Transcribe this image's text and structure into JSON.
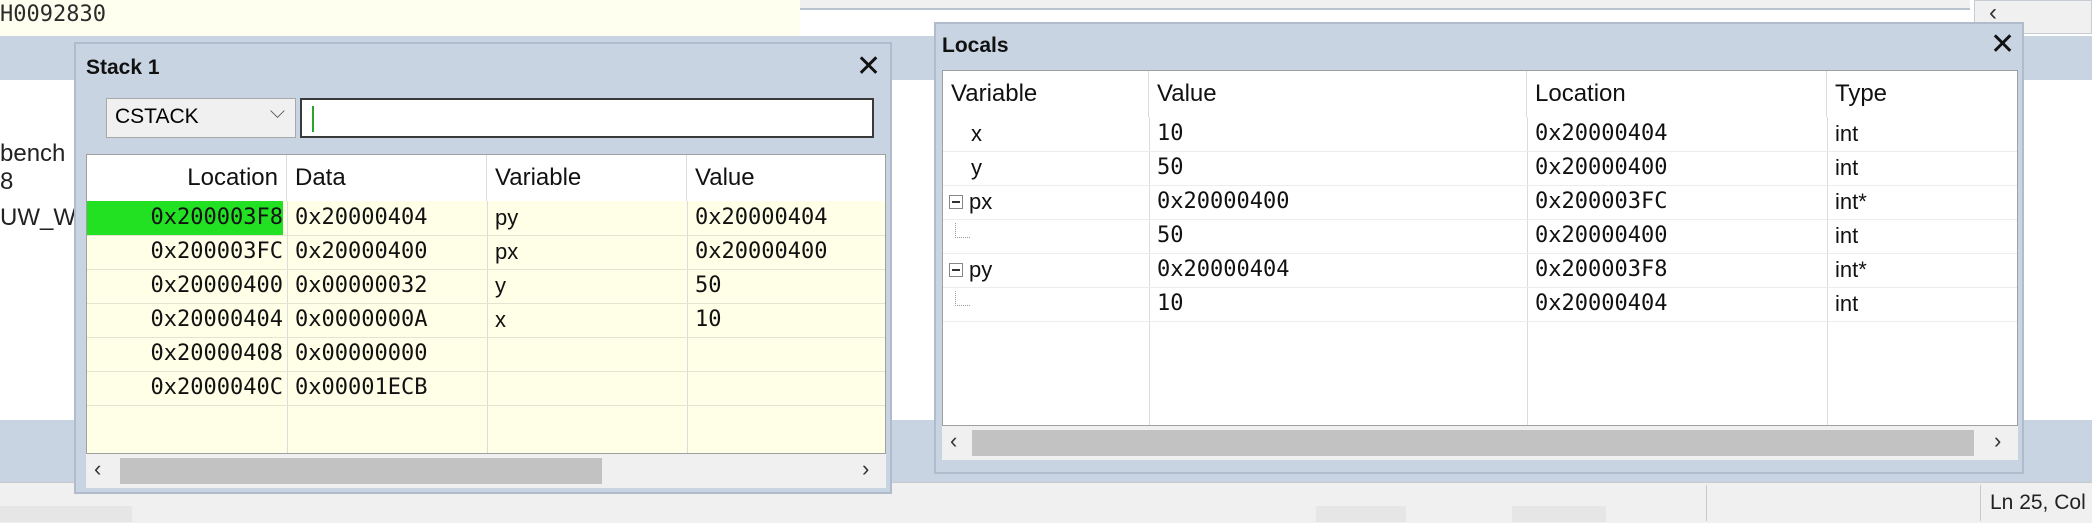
{
  "background": {
    "top_text": "H0092830",
    "side_texts": [
      "bench 8",
      "UW_W"
    ],
    "status_text": "Ln 25, Col"
  },
  "stack": {
    "title": "Stack 1",
    "combo_value": "CSTACK",
    "expression": "",
    "columns": [
      "Location",
      "Data",
      "Variable",
      "Value"
    ],
    "rows": [
      {
        "location": "0x200003F8",
        "data": "0x20000404",
        "variable": "py",
        "value": "0x20000404",
        "highlighted": true
      },
      {
        "location": "0x200003FC",
        "data": "0x20000400",
        "variable": "px",
        "value": "0x20000400"
      },
      {
        "location": "0x20000400",
        "data": "0x00000032",
        "variable": "y",
        "value": "50"
      },
      {
        "location": "0x20000404",
        "data": "0x0000000A",
        "variable": "x",
        "value": "10"
      },
      {
        "location": "0x20000408",
        "data": "0x00000000",
        "variable": "",
        "value": ""
      },
      {
        "location": "0x2000040C",
        "data": "0x00001ECB",
        "variable": "",
        "value": ""
      }
    ],
    "highlight_color": "#22e022"
  },
  "locals": {
    "title": "Locals",
    "columns": [
      "Variable",
      "Value",
      "Location",
      "Type"
    ],
    "rows": [
      {
        "variable": "x",
        "value": "10",
        "location": "0x20000404",
        "type": "int"
      },
      {
        "variable": "y",
        "value": "50",
        "location": "0x20000400",
        "type": "int"
      },
      {
        "variable": "px",
        "value": "0x20000400",
        "location": "0x200003FC",
        "type": "int*",
        "expander": "minus"
      },
      {
        "variable": "",
        "value": "50",
        "location": "0x20000400",
        "type": "int",
        "child": true
      },
      {
        "variable": "py",
        "value": "0x20000404",
        "location": "0x200003F8",
        "type": "int*",
        "expander": "minus"
      },
      {
        "variable": "",
        "value": "10",
        "location": "0x20000404",
        "type": "int",
        "child": true
      }
    ]
  },
  "icons": {
    "close": "close-icon",
    "dropdown": "chevron-down-icon",
    "scroll_left": "chevron-left-icon",
    "scroll_right": "chevron-right-icon",
    "collapse": "tree-collapse-icon"
  },
  "glyphs": {
    "close": "✕",
    "chevron_down": "⌵",
    "left": "‹",
    "right": "›"
  }
}
